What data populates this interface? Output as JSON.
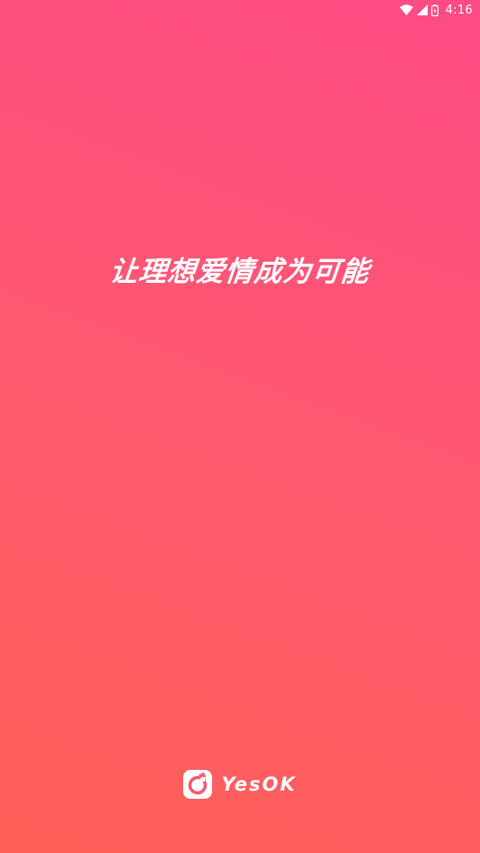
{
  "status_bar": {
    "time": "4:16",
    "icons": [
      "wifi-icon",
      "signal-icon",
      "battery-icon"
    ]
  },
  "splash": {
    "slogan": "让理想爱情成为可能"
  },
  "brand": {
    "logo_icon": "yesok-logo-icon",
    "name": "YesOK"
  },
  "colors": {
    "gradient_top": "#ff4b84",
    "gradient_bottom": "#ff5f57",
    "text": "#ffffff"
  }
}
